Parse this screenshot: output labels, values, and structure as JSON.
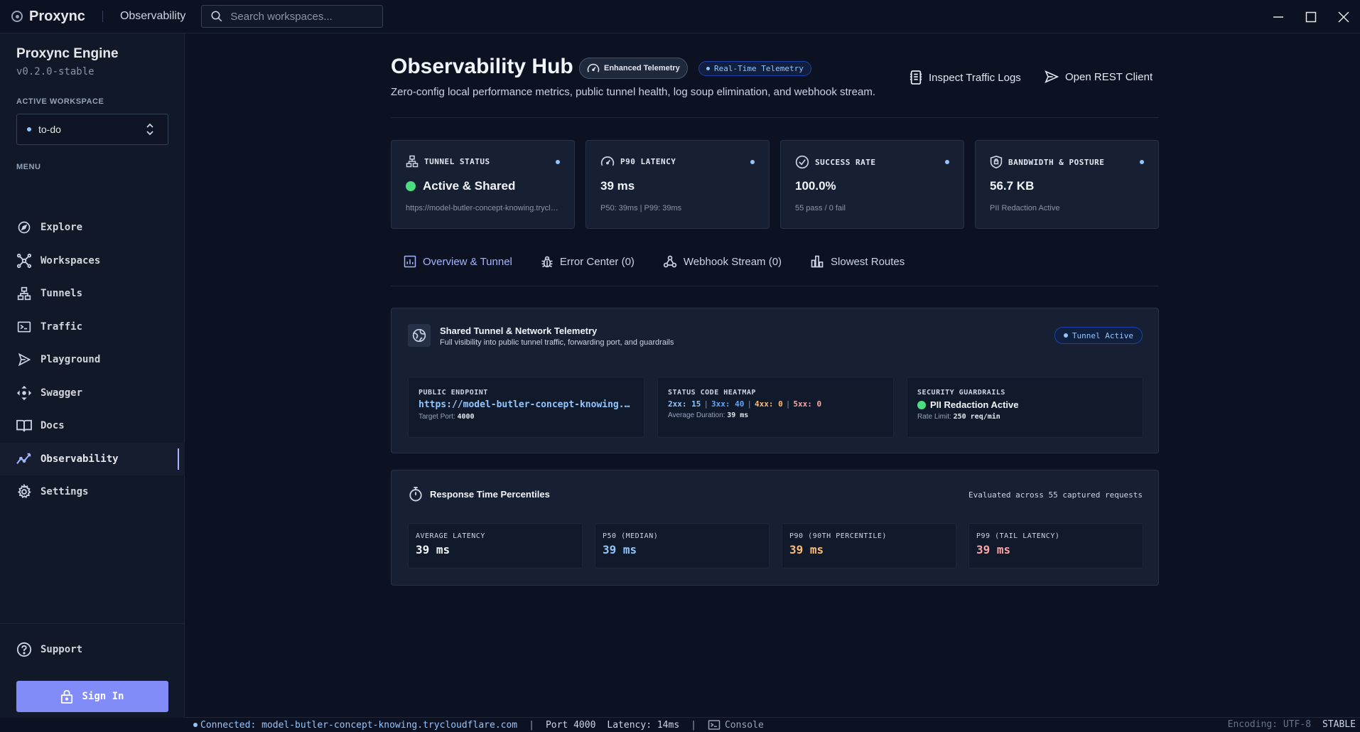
{
  "app": {
    "name": "Proxync",
    "title": "Observability",
    "search_placeholder": "Search workspaces..."
  },
  "sidebar": {
    "title": "Proxync Engine",
    "version": "v0.2.0-stable",
    "workspace_label": "ACTIVE WORKSPACE",
    "workspace": "to-do",
    "menu_label": "MENU",
    "items": [
      {
        "label": "Explore",
        "icon": "compass-icon"
      },
      {
        "label": "Workspaces",
        "icon": "network-icon"
      },
      {
        "label": "Tunnels",
        "icon": "sitemap-icon"
      },
      {
        "label": "Traffic",
        "icon": "terminal-icon"
      },
      {
        "label": "Playground",
        "icon": "send-icon"
      },
      {
        "label": "Swagger",
        "icon": "move-icon"
      },
      {
        "label": "Docs",
        "icon": "book-icon"
      },
      {
        "label": "Observability",
        "icon": "activity-icon"
      },
      {
        "label": "Settings",
        "icon": "gear-icon"
      }
    ],
    "active_item": "Observability",
    "support": "Support",
    "signin": "Sign In"
  },
  "header": {
    "title": "Observability Hub",
    "badge_enhanced": "Enhanced Telemetry",
    "badge_realtime": "Real-Time Telemetry",
    "subtitle": "Zero-config local performance metrics, public tunnel health, log soup elimination, and webhook stream.",
    "btn_inspect": "Inspect Traffic Logs",
    "btn_rest": "Open REST Client"
  },
  "cards": [
    {
      "label": "TUNNEL STATUS",
      "value": "Active & Shared",
      "sub": "https://model-butler-concept-knowing.trycloudflare.com"
    },
    {
      "label": "P90 LATENCY",
      "value": "39 ms",
      "sub": "P50: 39ms | P99: 39ms"
    },
    {
      "label": "SUCCESS RATE",
      "value": "100.0%",
      "sub": "55 pass / 0 fail"
    },
    {
      "label": "BANDWIDTH & POSTURE",
      "value": "56.7 KB",
      "sub": "PII Redaction Active"
    }
  ],
  "tabs": [
    {
      "label": "Overview & Tunnel"
    },
    {
      "label": "Error Center (0)"
    },
    {
      "label": "Webhook Stream (0)"
    },
    {
      "label": "Slowest Routes"
    }
  ],
  "tunnel_panel": {
    "title": "Shared Tunnel & Network Telemetry",
    "subtitle": "Full visibility into public tunnel traffic, forwarding port, and guardrails",
    "badge": "Tunnel Active",
    "endpoint_label": "PUBLIC ENDPOINT",
    "endpoint_value": "https://model-butler-concept-knowing.trycloudflare.com",
    "target_port_label": "Target Port:",
    "target_port": "4000",
    "heatmap_label": "STATUS CODE HEATMAP",
    "heat_2xx": "2xx: 15",
    "heat_3xx": "3xx: 40",
    "heat_4xx": "4xx: 0",
    "heat_5xx": "5xx: 0",
    "sep": "|",
    "avg_duration_label": "Average Duration:",
    "avg_duration": "39 ms",
    "guard_label": "SECURITY GUARDRAILS",
    "guard_value": "PII Redaction Active",
    "rate_limit_label": "Rate Limit:",
    "rate_limit": "250 req/min"
  },
  "percentiles": {
    "title": "Response Time Percentiles",
    "eval": "Evaluated across 55 captured requests",
    "items": [
      {
        "label": "AVERAGE LATENCY",
        "value": "39 ms",
        "color": "#f1f5f9"
      },
      {
        "label": "P50 (MEDIAN)",
        "value": "39 ms",
        "color": "#93c5fd"
      },
      {
        "label": "P90 (90TH PERCENTILE)",
        "value": "39 ms",
        "color": "#fdba74"
      },
      {
        "label": "P99 (TAIL LATENCY)",
        "value": "39 ms",
        "color": "#fca5a5"
      }
    ]
  },
  "statusbar": {
    "connected": "Connected: model-butler-concept-knowing.trycloudflare.com",
    "sep": "|",
    "port": "Port 4000",
    "latency": "Latency: 14ms",
    "console": "Console",
    "encoding": "Encoding: UTF-8",
    "stable": "STABLE"
  },
  "colors": {
    "accent": "#818cf8",
    "blue": "#93c5fd",
    "green": "#4ade80",
    "orange": "#fdba74",
    "red": "#fca5a5"
  }
}
